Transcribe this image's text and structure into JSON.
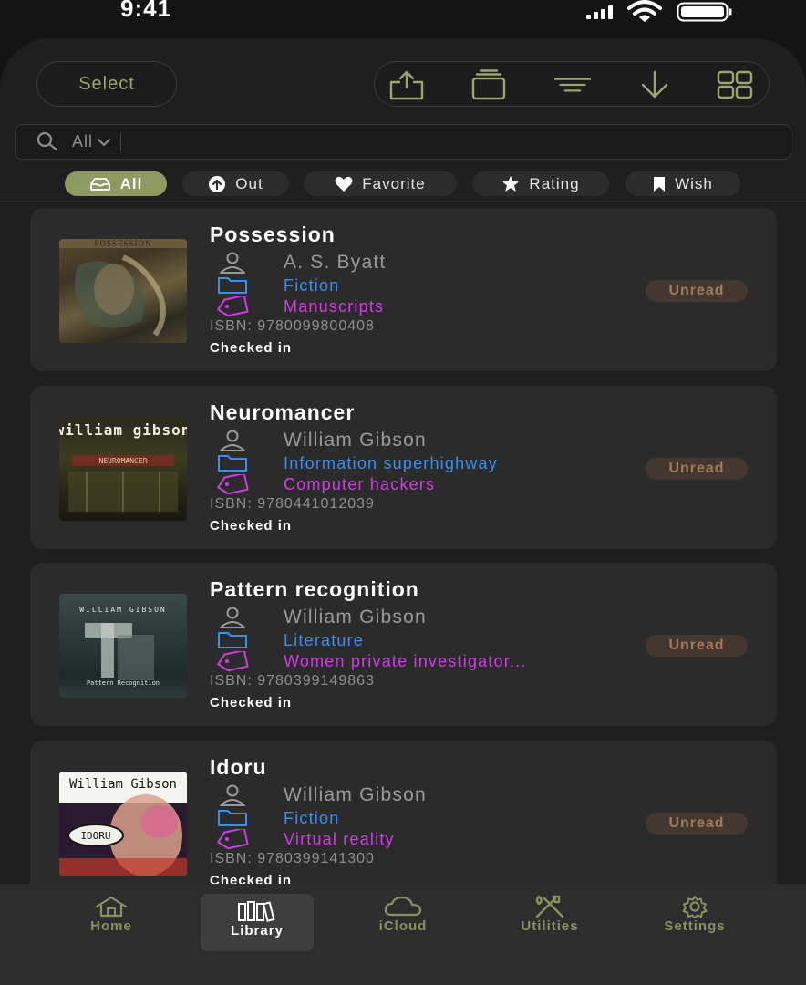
{
  "status": {
    "time": "9:41"
  },
  "header": {
    "select_label": "Select",
    "toolbar": [
      "share-icon",
      "stack-icon",
      "sort-icon",
      "download-icon",
      "grid-icon"
    ]
  },
  "search": {
    "scope": "All",
    "placeholder": ""
  },
  "filters": [
    {
      "label": "All",
      "icon": "tray-icon",
      "active": true
    },
    {
      "label": "Out",
      "icon": "arrow-up-circle-icon",
      "active": false
    },
    {
      "label": "Favorite",
      "icon": "heart-icon",
      "active": false
    },
    {
      "label": "Rating",
      "icon": "star-icon",
      "active": false
    },
    {
      "label": "Wish",
      "icon": "bookmark-icon",
      "active": false
    }
  ],
  "books": [
    {
      "title": "Possession",
      "author": "A. S. Byatt",
      "category": "Fiction",
      "tag": "Manuscripts",
      "isbn": "ISBN: 9780099800408",
      "status": "Checked in",
      "badge": "Unread",
      "cover_text": "POSSESSION"
    },
    {
      "title": "Neuromancer",
      "author": "William Gibson",
      "category": "Information superhighway",
      "tag": "Computer hackers",
      "isbn": "ISBN: 9780441012039",
      "status": "Checked in",
      "badge": "Unread",
      "cover_text": "william gibson"
    },
    {
      "title": "Pattern recognition",
      "author": "William Gibson",
      "category": "Literature",
      "tag": "Women private investigator...",
      "isbn": "ISBN: 9780399149863",
      "status": "Checked in",
      "badge": "Unread",
      "cover_text": "WILLIAM GIBSON"
    },
    {
      "title": "Idoru",
      "author": "William Gibson",
      "category": "Fiction",
      "tag": "Virtual reality",
      "isbn": "ISBN: 9780399141300",
      "status": "Checked in",
      "badge": "Unread",
      "cover_text": "William Gibson"
    }
  ],
  "tabs": [
    {
      "label": "Home",
      "icon": "house-icon",
      "active": false
    },
    {
      "label": "Library",
      "icon": "books-icon",
      "active": true
    },
    {
      "label": "iCloud",
      "icon": "cloud-icon",
      "active": false
    },
    {
      "label": "Utilities",
      "icon": "tools-icon",
      "active": false
    },
    {
      "label": "Settings",
      "icon": "gear-icon",
      "active": false
    }
  ],
  "colors": {
    "accent": "#8f9a63",
    "category": "#3a8ff2",
    "tag": "#d03ee3",
    "badge_bg": "#433730",
    "badge_text": "#a37a5e"
  }
}
